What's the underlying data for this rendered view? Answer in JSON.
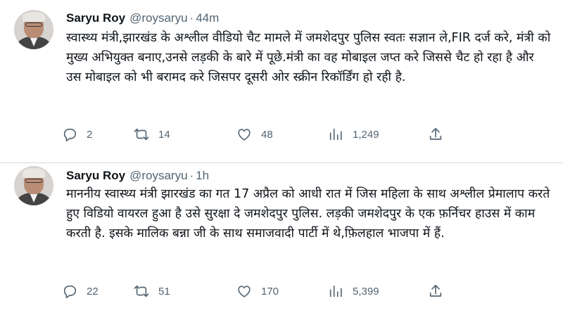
{
  "tweets": [
    {
      "author": {
        "name": "Saryu Roy",
        "handle": "@roysaryu",
        "time": "44m"
      },
      "text": "स्वास्थ्य मंत्री,झारखंड के अश्लील वीडियो चैट मामले में जमशेदपुर पुलिस स्वतः सज्ञान ले,FIR दर्ज करे, मंत्री को मुख्य अभियुक्त बनाए,उनसे लड़की के बारे में पूछे.मंत्री का वह मोबाइल जप्त करे जिससे चैट हो रहा है और उस मोबाइल को भी बरामद करे जिसपर दूसरी ओर स्क्रीन रिकॉर्डिंग हो रही है.",
      "actions": {
        "replies": "2",
        "retweets": "14",
        "likes": "48",
        "views": "1,249"
      }
    },
    {
      "author": {
        "name": "Saryu Roy",
        "handle": "@roysaryu",
        "time": "1h"
      },
      "text": "माननीय स्वास्थ्य मंत्री झारखंड का गत 17 अप्रैल को आधी रात में जिस महिला के साथ अश्लील प्रेमालाप करते हुए विडियो वायरल हुआ है उसे सुरक्षा दे जमशेदपुर पुलिस. लड़की जमशेदपुर के एक फ़र्निचर हाउस में काम करती है. इसके मालिक बन्ना जी के साथ समाजवादी पार्टी में थे,फ़िलहाल भाजपा में हैं.",
      "actions": {
        "replies": "22",
        "retweets": "51",
        "likes": "170",
        "views": "5,399"
      }
    }
  ],
  "separator": "·",
  "icons": [
    "reply-icon",
    "retweet-icon",
    "like-icon",
    "views-icon",
    "share-icon"
  ]
}
